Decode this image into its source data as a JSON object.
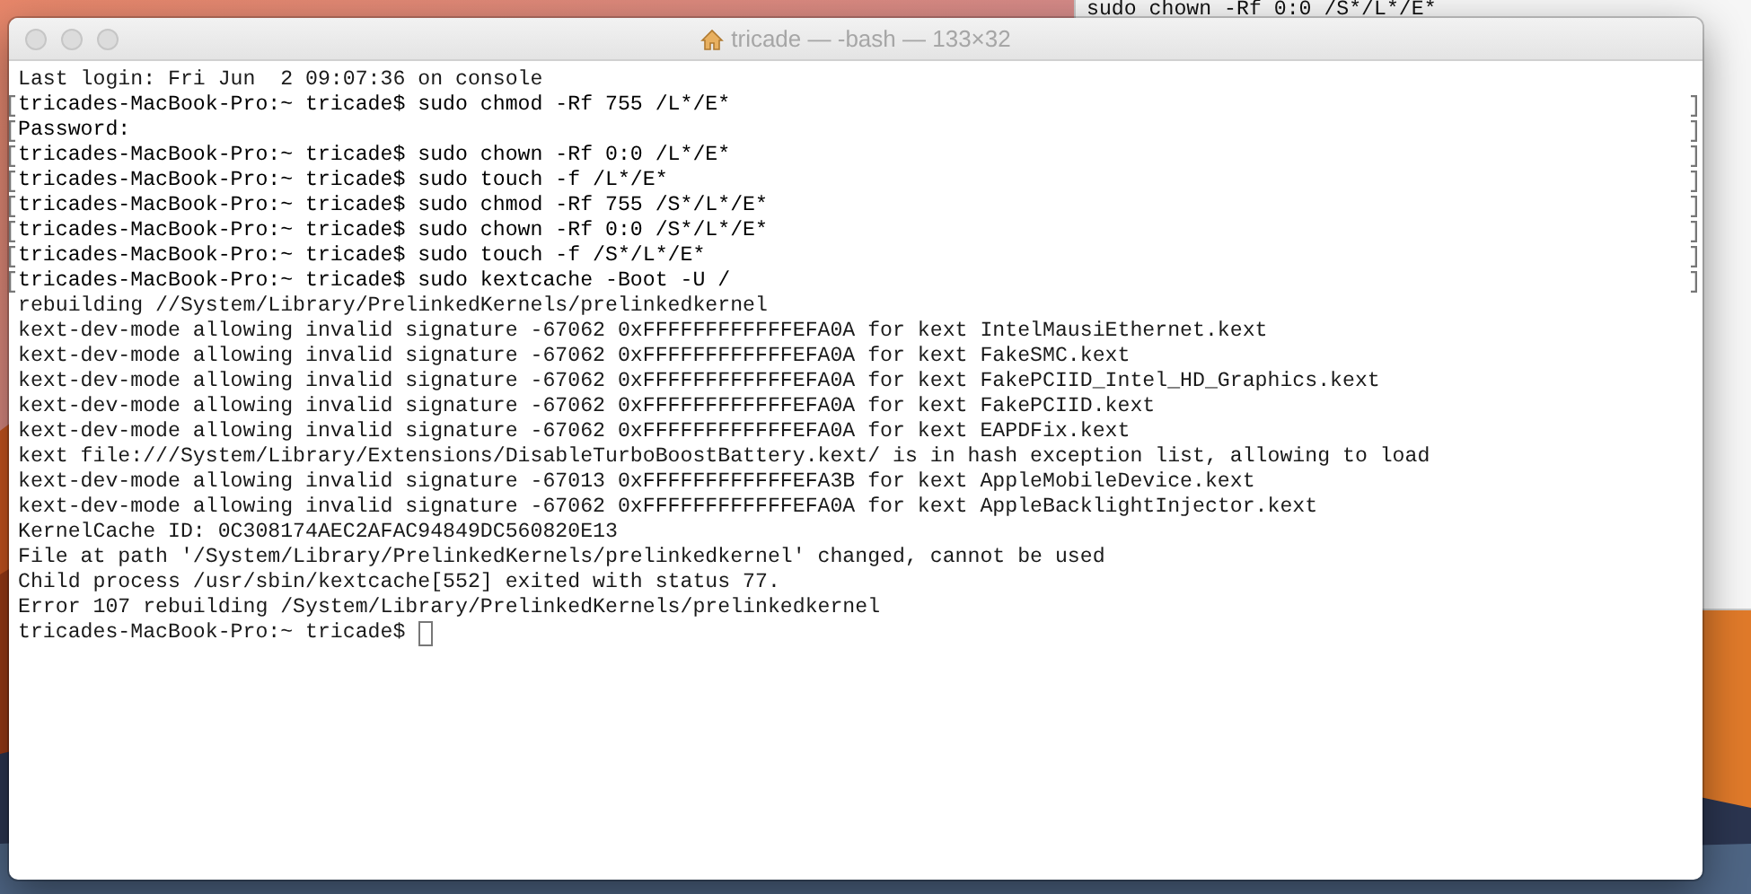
{
  "background_window": {
    "lines": [
      "sudo chown -Rf 0:0 /S*/L*/E*"
    ]
  },
  "window": {
    "title": "tricade — -bash — 133×32",
    "lines": [
      {
        "text": "Last login: Fri Jun  2 09:07:36 on console",
        "marked": false,
        "cursor": false
      },
      {
        "text": "tricades-MacBook-Pro:~ tricade$ sudo chmod -Rf 755 /L*/E*",
        "marked": true,
        "cursor": false
      },
      {
        "text": "Password:",
        "marked": true,
        "cursor": false
      },
      {
        "text": "tricades-MacBook-Pro:~ tricade$ sudo chown -Rf 0:0 /L*/E*",
        "marked": true,
        "cursor": false
      },
      {
        "text": "tricades-MacBook-Pro:~ tricade$ sudo touch -f /L*/E*",
        "marked": true,
        "cursor": false
      },
      {
        "text": "tricades-MacBook-Pro:~ tricade$ sudo chmod -Rf 755 /S*/L*/E*",
        "marked": true,
        "cursor": false
      },
      {
        "text": "tricades-MacBook-Pro:~ tricade$ sudo chown -Rf 0:0 /S*/L*/E*",
        "marked": true,
        "cursor": false
      },
      {
        "text": "tricades-MacBook-Pro:~ tricade$ sudo touch -f /S*/L*/E*",
        "marked": true,
        "cursor": false
      },
      {
        "text": "tricades-MacBook-Pro:~ tricade$ sudo kextcache -Boot -U /",
        "marked": true,
        "cursor": false
      },
      {
        "text": "rebuilding //System/Library/PrelinkedKernels/prelinkedkernel",
        "marked": false,
        "cursor": false
      },
      {
        "text": "kext-dev-mode allowing invalid signature -67062 0xFFFFFFFFFFFFEFA0A for kext IntelMausiEthernet.kext",
        "marked": false,
        "cursor": false
      },
      {
        "text": "kext-dev-mode allowing invalid signature -67062 0xFFFFFFFFFFFFEFA0A for kext FakeSMC.kext",
        "marked": false,
        "cursor": false
      },
      {
        "text": "kext-dev-mode allowing invalid signature -67062 0xFFFFFFFFFFFFEFA0A for kext FakePCIID_Intel_HD_Graphics.kext",
        "marked": false,
        "cursor": false
      },
      {
        "text": "kext-dev-mode allowing invalid signature -67062 0xFFFFFFFFFFFFEFA0A for kext FakePCIID.kext",
        "marked": false,
        "cursor": false
      },
      {
        "text": "kext-dev-mode allowing invalid signature -67062 0xFFFFFFFFFFFFEFA0A for kext EAPDFix.kext",
        "marked": false,
        "cursor": false
      },
      {
        "text": "kext file:///System/Library/Extensions/DisableTurboBoostBattery.kext/ is in hash exception list, allowing to load",
        "marked": false,
        "cursor": false
      },
      {
        "text": "kext-dev-mode allowing invalid signature -67013 0xFFFFFFFFFFFFEFA3B for kext AppleMobileDevice.kext",
        "marked": false,
        "cursor": false
      },
      {
        "text": "kext-dev-mode allowing invalid signature -67062 0xFFFFFFFFFFFFEFA0A for kext AppleBacklightInjector.kext",
        "marked": false,
        "cursor": false
      },
      {
        "text": "KernelCache ID: 0C308174AEC2AFAC94849DC560820E13",
        "marked": false,
        "cursor": false
      },
      {
        "text": "File at path '/System/Library/PrelinkedKernels/prelinkedkernel' changed, cannot be used",
        "marked": false,
        "cursor": false
      },
      {
        "text": "Child process /usr/sbin/kextcache[552] exited with status 77.",
        "marked": false,
        "cursor": false
      },
      {
        "text": "Error 107 rebuilding /System/Library/PrelinkedKernels/prelinkedkernel",
        "marked": false,
        "cursor": false
      },
      {
        "text": "tricades-MacBook-Pro:~ tricade$",
        "marked": false,
        "cursor": true
      }
    ]
  }
}
